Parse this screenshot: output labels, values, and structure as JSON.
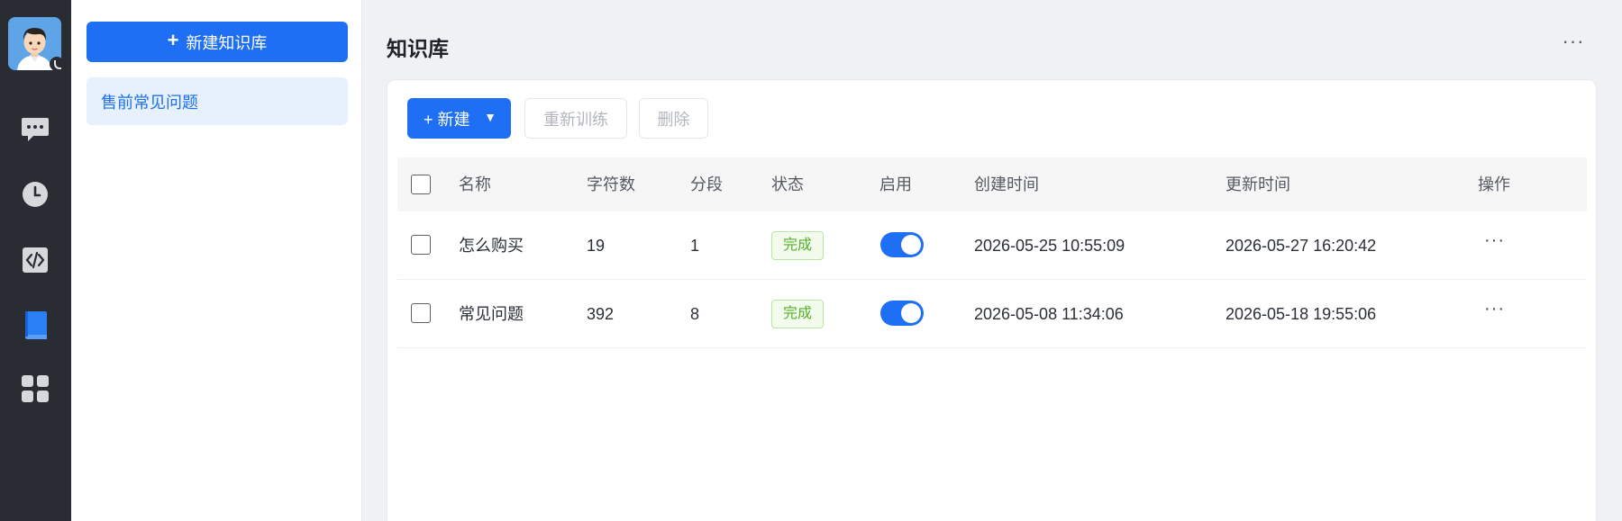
{
  "sidebar": {
    "avatar_icon": "avatar-icon",
    "nav_items": [
      {
        "icon": "chat-bubble-icon"
      },
      {
        "icon": "clock-icon"
      },
      {
        "icon": "code-icon"
      },
      {
        "icon": "book-icon",
        "active": true
      },
      {
        "icon": "grid-apps-icon"
      }
    ]
  },
  "kb_panel": {
    "new_button_label": "新建知识库",
    "items": [
      {
        "label": "售前常见问题",
        "selected": true
      }
    ]
  },
  "main": {
    "title": "知识库",
    "toolbar": {
      "new_label": "+ 新建",
      "retrain_label": "重新训练",
      "delete_label": "删除"
    },
    "table": {
      "columns": [
        "名称",
        "字符数",
        "分段",
        "状态",
        "启用",
        "创建时间",
        "更新时间",
        "操作"
      ],
      "rows": [
        {
          "name": "怎么购买",
          "chars": "19",
          "segments": "1",
          "status": "完成",
          "enabled": true,
          "created": "2026-05-25 10:55:09",
          "updated": "2026-05-27 16:20:42"
        },
        {
          "name": "常见问题",
          "chars": "392",
          "segments": "8",
          "status": "完成",
          "enabled": true,
          "created": "2026-05-08 11:34:06",
          "updated": "2026-05-18 19:55:06"
        }
      ]
    }
  },
  "colors": {
    "accent": "#1e6ff3",
    "rail_bg": "#292c33",
    "status_success": "#52b228"
  }
}
